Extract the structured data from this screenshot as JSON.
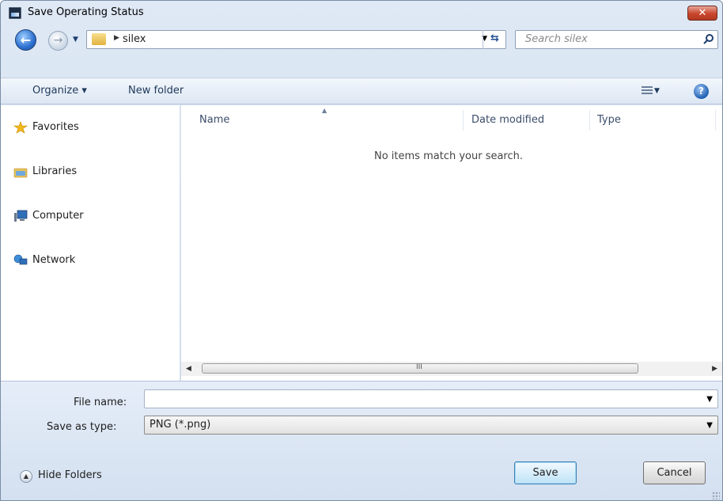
{
  "window": {
    "title": "Save Operating Status",
    "close_label": "✕"
  },
  "address_bar": {
    "breadcrumb": [
      "silex"
    ],
    "search_placeholder": "Search silex"
  },
  "toolbar": {
    "organize_label": "Organize ▾",
    "new_folder_label": "New folder"
  },
  "sidebar": {
    "items": [
      {
        "label": "Favorites",
        "icon": "star-icon"
      },
      {
        "label": "Libraries",
        "icon": "libraries-icon"
      },
      {
        "label": "Computer",
        "icon": "computer-icon"
      },
      {
        "label": "Network",
        "icon": "network-icon"
      }
    ]
  },
  "file_list": {
    "columns": [
      "Name",
      "Date modified",
      "Type"
    ],
    "empty_message": "No items match your search.",
    "scroll_grip": "III"
  },
  "form": {
    "file_name_label": "File name:",
    "file_name_value": "",
    "save_as_type_label": "Save as type:",
    "save_as_type_value": "PNG (*.png)"
  },
  "footer": {
    "hide_folders_label": "Hide Folders",
    "save_label": "Save",
    "cancel_label": "Cancel"
  },
  "colors": {
    "accent": "#2c6fcf",
    "close": "#c9462c"
  }
}
